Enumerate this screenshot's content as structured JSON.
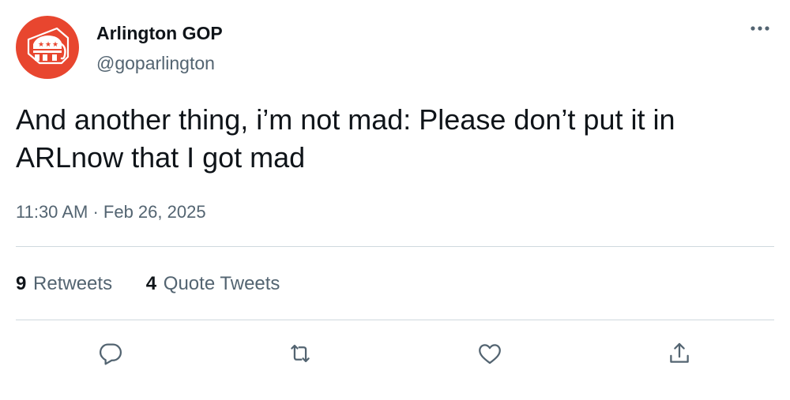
{
  "account": {
    "display_name": "Arlington GOP",
    "handle": "@goparlington",
    "avatar_icon": "gop-elephant-logo",
    "avatar_color": "#e8462f"
  },
  "tweet": {
    "text": "And another thing, i’m not mad: Please don’t put it in ARLnow that I got mad",
    "time": "11:30 AM",
    "separator": "·",
    "date": "Feb 26, 2025"
  },
  "stats": {
    "retweets": {
      "count": "9",
      "label": "Retweets"
    },
    "quote_tweets": {
      "count": "4",
      "label": "Quote Tweets"
    }
  },
  "actions": {
    "reply_icon": "reply-bubble-icon",
    "retweet_icon": "retweet-icon",
    "like_icon": "heart-icon",
    "share_icon": "share-icon"
  },
  "colors": {
    "text_primary": "#0f1419",
    "text_secondary": "#536471",
    "divider": "#cfd9de"
  }
}
